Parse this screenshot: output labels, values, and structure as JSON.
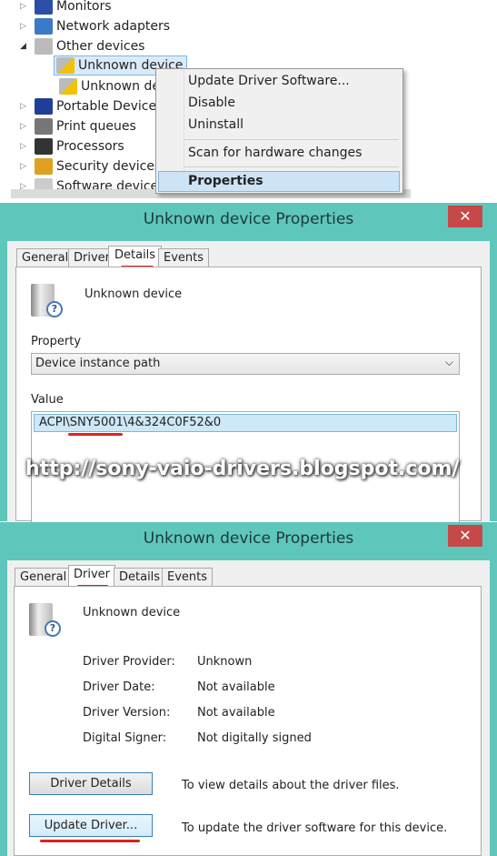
{
  "tree": {
    "items": [
      {
        "label": "Monitors",
        "expander": "collapsed",
        "icon": "monitor-icon"
      },
      {
        "label": "Network adapters",
        "expander": "collapsed",
        "icon": "network-icon"
      },
      {
        "label": "Other devices",
        "expander": "expanded",
        "icon": "unknown-device-icon"
      },
      {
        "label": "Unknown device",
        "expander": "none",
        "icon": "warning-device-icon",
        "selected": true
      },
      {
        "label": "Unknown device",
        "expander": "none",
        "icon": "warning-device-icon"
      },
      {
        "label": "Portable Devices",
        "expander": "collapsed",
        "icon": "portable-device-icon"
      },
      {
        "label": "Print queues",
        "expander": "collapsed",
        "icon": "printer-icon"
      },
      {
        "label": "Processors",
        "expander": "collapsed",
        "icon": "processor-icon"
      },
      {
        "label": "Security devices",
        "expander": "collapsed",
        "icon": "key-icon"
      },
      {
        "label": "Software devices",
        "expander": "collapsed",
        "icon": "software-device-icon"
      }
    ]
  },
  "context_menu": {
    "items": [
      "Update Driver Software...",
      "Disable",
      "Uninstall",
      "Scan for hardware changes",
      "Properties"
    ],
    "highlighted": "Properties"
  },
  "dialog1": {
    "title": "Unknown device Properties",
    "close": "✕",
    "tabs": [
      "General",
      "Driver",
      "Details",
      "Events"
    ],
    "active_tab": "Details",
    "device_name": "Unknown device",
    "property_label": "Property",
    "property_value": "Device instance path",
    "value_label": "Value",
    "value_prefix": "ACPI\\",
    "value_highlight": "SNY5001\\",
    "value_suffix": "4&324C0F52&0"
  },
  "watermark": "http://sony-vaio-drivers.blogspot.com/",
  "dialog2": {
    "title": "Unknown device Properties",
    "close": "✕",
    "tabs": [
      "General",
      "Driver",
      "Details",
      "Events"
    ],
    "active_tab": "Driver",
    "device_name": "Unknown device",
    "fields": [
      {
        "label": "Driver Provider:",
        "value": "Unknown"
      },
      {
        "label": "Driver Date:",
        "value": "Not available"
      },
      {
        "label": "Driver Version:",
        "value": "Not available"
      },
      {
        "label": "Digital Signer:",
        "value": "Not digitally signed"
      }
    ],
    "buttons": [
      {
        "label": "Driver Details",
        "desc": "To view details about the driver files."
      },
      {
        "label": "Update Driver...",
        "desc": "To update the driver software for this device."
      }
    ]
  },
  "colors": {
    "accent": "#5fc6bb",
    "close": "#c74848",
    "highlight": "#cce4f7",
    "underline": "#dd2222"
  }
}
